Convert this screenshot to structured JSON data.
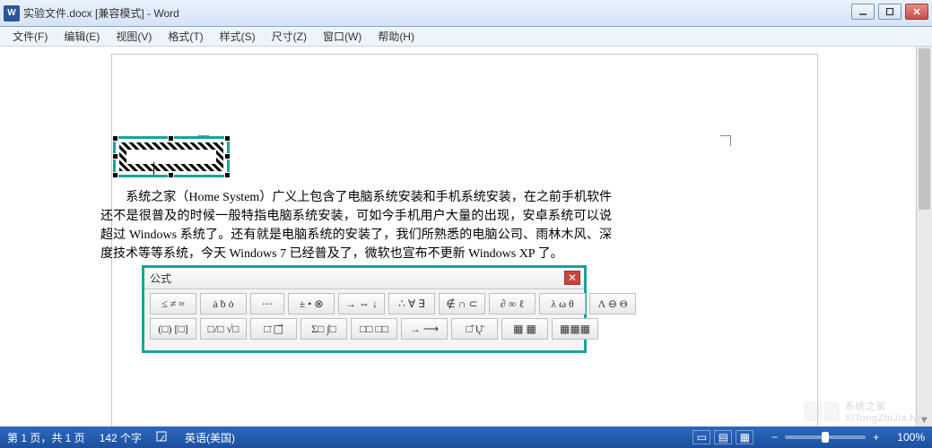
{
  "window": {
    "app_icon_letter": "W",
    "title": "实验文件.docx [兼容模式] - Word"
  },
  "menu": {
    "file": "文件(F)",
    "edit": "编辑(E)",
    "view": "视图(V)",
    "format": "格式(T)",
    "style": "样式(S)",
    "size": "尺寸(Z)",
    "window": "窗口(W)",
    "help": "帮助(H)"
  },
  "document": {
    "paragraph": "        系统之家（Home System）广义上包含了电脑系统安装和手机系统安装，在之前手机软件还不是很普及的时候一般特指电脑系统安装，可如今手机用户大量的出现，安卓系统可以说超过 Windows 系统了。还有就是电脑系统的安装了，我们所熟悉的电脑公司、雨林木风、深度技术等等系统，今天 Windows 7 已经普及了，微软也宣布不更新 Windows XP 了。"
  },
  "formula": {
    "title": "公式",
    "row1": {
      "b1": "≤ ≠ ≈",
      "b2": "ȧ ḃ ȯ",
      "b3": "⋯",
      "b4": "± • ⊗",
      "b5": "→ ⇔ ↓",
      "b6": "∴ ∀ ∃",
      "b7": "∉ ∩ ⊂",
      "b8": "∂ ∞ ℓ",
      "b9": "λ ω θ",
      "b10": "Λ ⊖ Θ"
    },
    "row2": {
      "b1": "(□) [□]",
      "b2": "□/□  √□",
      "b3": "□̄  □⃗",
      "b4": "Σ□  ∫□",
      "b5": "□□  □□",
      "b6": "→  ⟶",
      "b7": "□̂   Ų̈",
      "b8": "▦ ▦",
      "b9": "▦▦▦"
    }
  },
  "status": {
    "page": "第 1 页，共 1 页",
    "words": "142 个字",
    "spell_icon": "⬚",
    "language": "英语(美国)",
    "zoom": "100%"
  },
  "watermark": {
    "text": "系统之家",
    "url": "XiTongZhiJia.Net"
  }
}
